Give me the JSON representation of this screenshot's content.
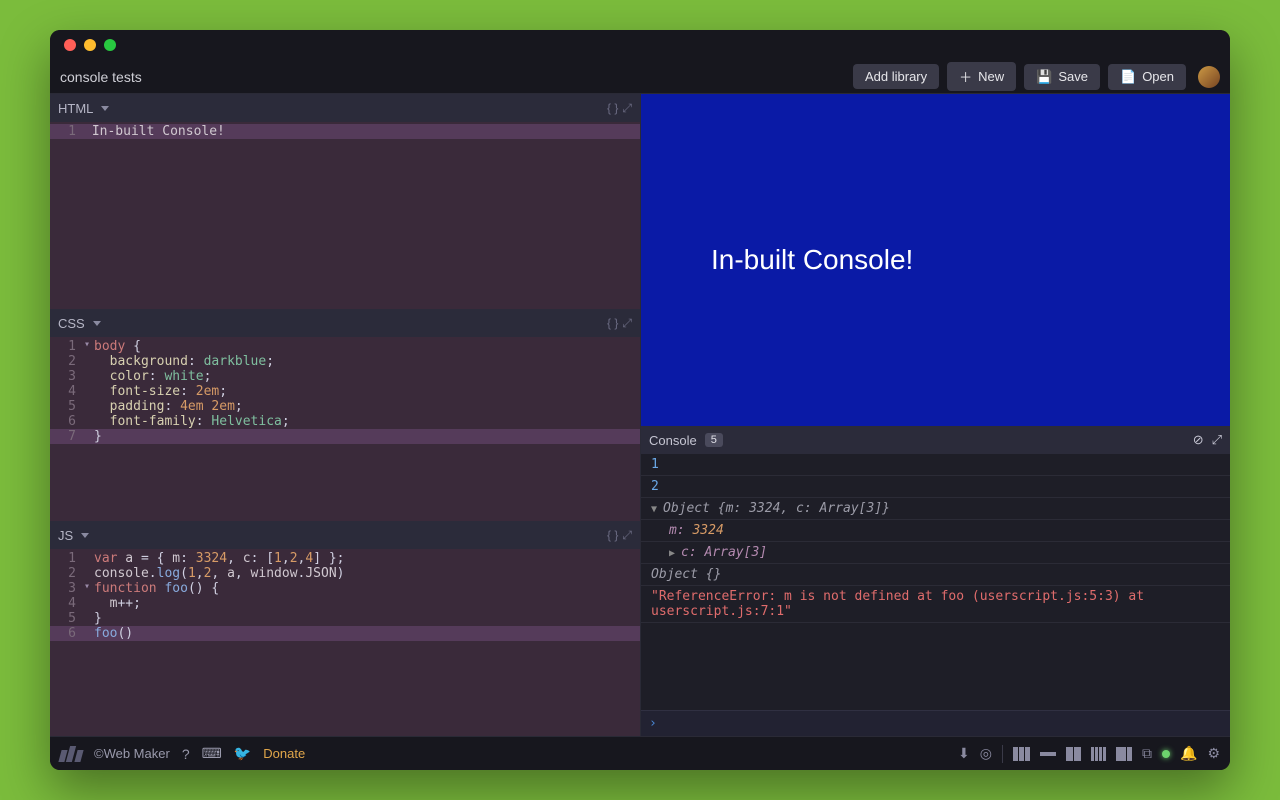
{
  "project_title": "console tests",
  "toolbar": {
    "add_library": "Add library",
    "new": "New",
    "save": "Save",
    "open": "Open"
  },
  "panes": {
    "html": {
      "label": "HTML"
    },
    "css": {
      "label": "CSS"
    },
    "js": {
      "label": "JS"
    }
  },
  "code": {
    "html_lines": [
      "In-built Console!"
    ],
    "css_lines": [
      "body {",
      "  background: darkblue;",
      "  color: white;",
      "  font-size: 2em;",
      "  padding: 4em 2em;",
      "  font-family: Helvetica;",
      "}"
    ],
    "js_lines": [
      "var a = { m: 3324, c: [1,2,4] };",
      "console.log(1,2, a, window.JSON)",
      "function foo() {",
      "  m++;",
      "}",
      "foo()"
    ]
  },
  "preview": {
    "text": "In-built Console!"
  },
  "console": {
    "label": "Console",
    "count": "5",
    "rows": {
      "r1": "1",
      "r2": "2",
      "r3": "Object {m: 3324, c: Array[3]}",
      "r3a_key": "m:",
      "r3a_val": "3324",
      "r3b": "c: Array[3]",
      "r4": "Object {}",
      "err": "\"ReferenceError: m is not defined at foo (userscript.js:5:3) at userscript.js:7:1\""
    },
    "prompt": "›"
  },
  "footer": {
    "brand": "©Web Maker",
    "donate": "Donate"
  }
}
